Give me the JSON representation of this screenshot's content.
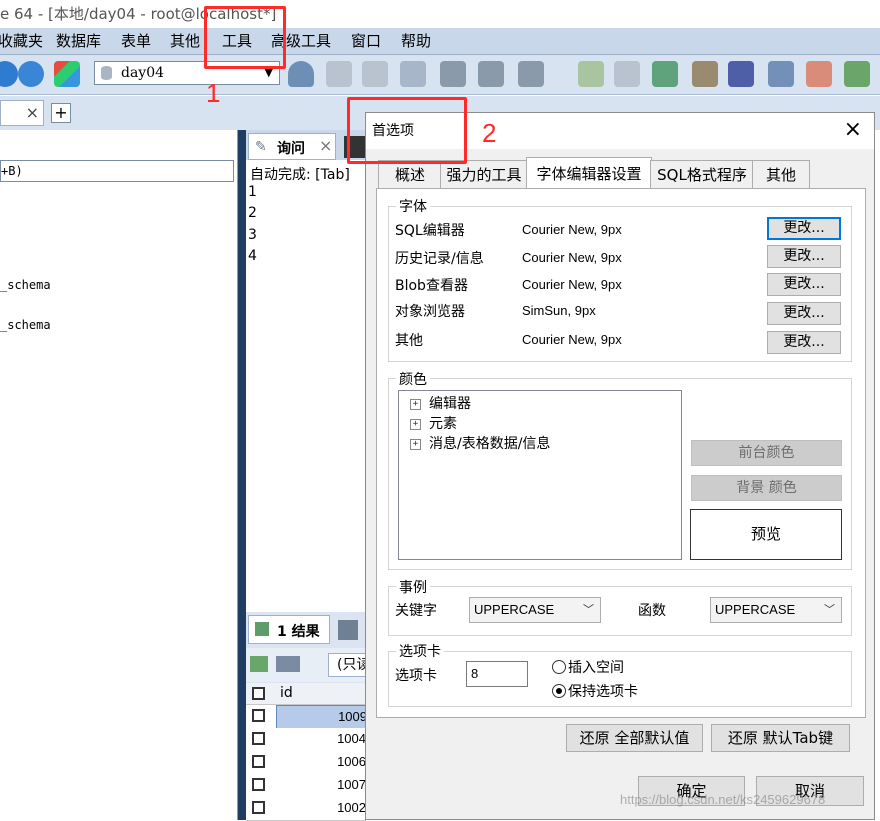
{
  "window": {
    "title": "e 64 - [本地/day04 - root@localhost*]"
  },
  "menu": [
    "收藏夹",
    "数据库",
    "表单",
    "其他",
    "工具",
    "高级工具",
    "窗口",
    "帮助"
  ],
  "toolbar": {
    "database_select": "day04"
  },
  "left_pane": {
    "lines": [
      "+B)",
      "_schema",
      "_schema"
    ]
  },
  "query": {
    "tab_label": "询问",
    "autocomplete_text": "自动完成: [Tab]",
    "line_numbers": [
      "1",
      "2",
      "3",
      "4"
    ]
  },
  "results": {
    "tab_label": "1 结果",
    "readonly_label": "(只读",
    "column_header": "id",
    "rows": [
      "1009",
      "1004",
      "1006",
      "1007",
      "1002"
    ]
  },
  "annotations": {
    "box1_number": "1",
    "box2_number": "2"
  },
  "dialog": {
    "title": "首选项",
    "close_icon": "×",
    "tabs": [
      "概述",
      "强力的工具",
      "字体编辑器设置",
      "SQL格式程序",
      "其他"
    ],
    "active_tab": "字体编辑器设置",
    "fonts_group": {
      "label": "字体",
      "rows": [
        {
          "name": "SQL编辑器",
          "value": "Courier New, 9px",
          "button": "更改..."
        },
        {
          "name": "历史记录/信息",
          "value": "Courier New, 9px",
          "button": "更改..."
        },
        {
          "name": "Blob查看器",
          "value": "Courier New, 9px",
          "button": "更改..."
        },
        {
          "name": "对象浏览器",
          "value": "SimSun, 9px",
          "button": "更改..."
        },
        {
          "name": "其他",
          "value": "Courier New, 9px",
          "button": "更改..."
        }
      ]
    },
    "colors_group": {
      "label": "颜色",
      "tree": [
        "编辑器",
        "元素",
        "消息/表格数据/信息"
      ],
      "foreground_button": "前台颜色",
      "background_button": "背景 颜色",
      "preview_label": "预览"
    },
    "case_group": {
      "label": "事例",
      "keyword_label": "关键字",
      "keyword_value": "UPPERCASE",
      "function_label": "函数",
      "function_value": "UPPERCASE"
    },
    "tab_group": {
      "label": "选项卡",
      "tab_label": "选项卡",
      "tab_value": "8",
      "insert_spaces": "插入空间",
      "keep_tabs": "保持选项卡",
      "selected": "keep_tabs"
    },
    "restore_all_button": "还原 全部默认值",
    "restore_tab_button": "还原 默认Tab键",
    "ok_button": "确定",
    "cancel_button": "取消"
  },
  "watermark": "https://blog.csdn.net/ks2459629678",
  "colors": {
    "menubar": "#c9d7ea",
    "annotation": "#ff2b2b",
    "accent": "#0078d7"
  }
}
